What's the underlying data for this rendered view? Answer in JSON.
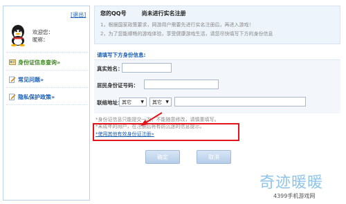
{
  "sidebar": {
    "logout_label": "[退出]",
    "welcome_label": "欢迎您：",
    "nickname_label": "昵称：",
    "items": [
      {
        "label": "身份证信息查询»"
      },
      {
        "label": "常见问题»"
      },
      {
        "label": "隐私保护政策»"
      }
    ]
  },
  "notice": {
    "account_prefix": "您的QQ号",
    "status": "尚未进行实名注册",
    "line1": "1，根据国家政策要求，网游用户需要先进行实名注册后，再进入游戏！",
    "line2": "2，为了您能顺畅的游戏体验，享受健康游戏生活，请您尽快填写下方的身份信息"
  },
  "form": {
    "heading": "请填写下方身份信息:",
    "real_name_label": "真实姓名：",
    "id_label": "居民身份证号码：",
    "address_label": "联络地址：",
    "province_select": "其它",
    "city_select": "其它"
  },
  "hints": {
    "line1": "*身份证信息只能提交一次，不能随意修改，请慎重填写。",
    "line2": "*未成年的用户，在注册后将有防沉迷的信息提示。",
    "other_id_link": "*使用其他有效身份证注册»"
  },
  "buttons": {
    "confirm": "确定",
    "cancel": "取消"
  },
  "watermark": {
    "title": "奇迹暖暖",
    "subtitle": "4399手机游戏网"
  },
  "colors": {
    "link": "#1a5fb4",
    "highlight": "#e0141a",
    "active_menu": "#3a8a1a"
  }
}
